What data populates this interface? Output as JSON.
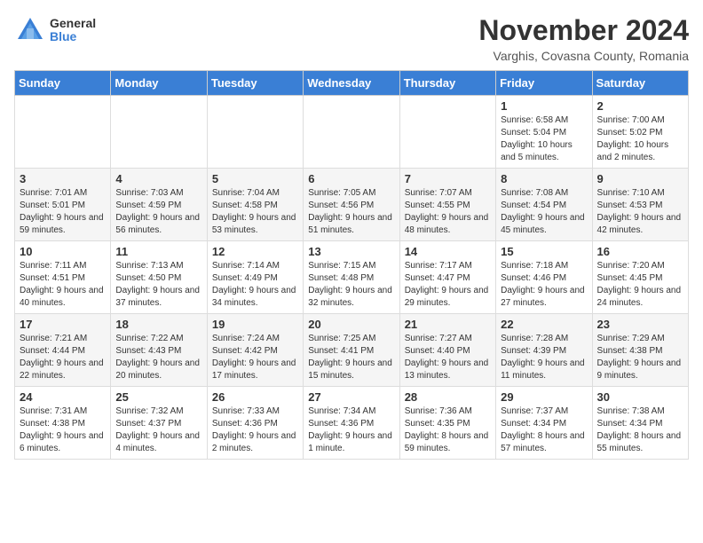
{
  "header": {
    "logo_general": "General",
    "logo_blue": "Blue",
    "month_title": "November 2024",
    "location": "Varghis, Covasna County, Romania"
  },
  "days_of_week": [
    "Sunday",
    "Monday",
    "Tuesday",
    "Wednesday",
    "Thursday",
    "Friday",
    "Saturday"
  ],
  "weeks": [
    [
      {
        "day": "",
        "info": ""
      },
      {
        "day": "",
        "info": ""
      },
      {
        "day": "",
        "info": ""
      },
      {
        "day": "",
        "info": ""
      },
      {
        "day": "",
        "info": ""
      },
      {
        "day": "1",
        "info": "Sunrise: 6:58 AM\nSunset: 5:04 PM\nDaylight: 10 hours and 5 minutes."
      },
      {
        "day": "2",
        "info": "Sunrise: 7:00 AM\nSunset: 5:02 PM\nDaylight: 10 hours and 2 minutes."
      }
    ],
    [
      {
        "day": "3",
        "info": "Sunrise: 7:01 AM\nSunset: 5:01 PM\nDaylight: 9 hours and 59 minutes."
      },
      {
        "day": "4",
        "info": "Sunrise: 7:03 AM\nSunset: 4:59 PM\nDaylight: 9 hours and 56 minutes."
      },
      {
        "day": "5",
        "info": "Sunrise: 7:04 AM\nSunset: 4:58 PM\nDaylight: 9 hours and 53 minutes."
      },
      {
        "day": "6",
        "info": "Sunrise: 7:05 AM\nSunset: 4:56 PM\nDaylight: 9 hours and 51 minutes."
      },
      {
        "day": "7",
        "info": "Sunrise: 7:07 AM\nSunset: 4:55 PM\nDaylight: 9 hours and 48 minutes."
      },
      {
        "day": "8",
        "info": "Sunrise: 7:08 AM\nSunset: 4:54 PM\nDaylight: 9 hours and 45 minutes."
      },
      {
        "day": "9",
        "info": "Sunrise: 7:10 AM\nSunset: 4:53 PM\nDaylight: 9 hours and 42 minutes."
      }
    ],
    [
      {
        "day": "10",
        "info": "Sunrise: 7:11 AM\nSunset: 4:51 PM\nDaylight: 9 hours and 40 minutes."
      },
      {
        "day": "11",
        "info": "Sunrise: 7:13 AM\nSunset: 4:50 PM\nDaylight: 9 hours and 37 minutes."
      },
      {
        "day": "12",
        "info": "Sunrise: 7:14 AM\nSunset: 4:49 PM\nDaylight: 9 hours and 34 minutes."
      },
      {
        "day": "13",
        "info": "Sunrise: 7:15 AM\nSunset: 4:48 PM\nDaylight: 9 hours and 32 minutes."
      },
      {
        "day": "14",
        "info": "Sunrise: 7:17 AM\nSunset: 4:47 PM\nDaylight: 9 hours and 29 minutes."
      },
      {
        "day": "15",
        "info": "Sunrise: 7:18 AM\nSunset: 4:46 PM\nDaylight: 9 hours and 27 minutes."
      },
      {
        "day": "16",
        "info": "Sunrise: 7:20 AM\nSunset: 4:45 PM\nDaylight: 9 hours and 24 minutes."
      }
    ],
    [
      {
        "day": "17",
        "info": "Sunrise: 7:21 AM\nSunset: 4:44 PM\nDaylight: 9 hours and 22 minutes."
      },
      {
        "day": "18",
        "info": "Sunrise: 7:22 AM\nSunset: 4:43 PM\nDaylight: 9 hours and 20 minutes."
      },
      {
        "day": "19",
        "info": "Sunrise: 7:24 AM\nSunset: 4:42 PM\nDaylight: 9 hours and 17 minutes."
      },
      {
        "day": "20",
        "info": "Sunrise: 7:25 AM\nSunset: 4:41 PM\nDaylight: 9 hours and 15 minutes."
      },
      {
        "day": "21",
        "info": "Sunrise: 7:27 AM\nSunset: 4:40 PM\nDaylight: 9 hours and 13 minutes."
      },
      {
        "day": "22",
        "info": "Sunrise: 7:28 AM\nSunset: 4:39 PM\nDaylight: 9 hours and 11 minutes."
      },
      {
        "day": "23",
        "info": "Sunrise: 7:29 AM\nSunset: 4:38 PM\nDaylight: 9 hours and 9 minutes."
      }
    ],
    [
      {
        "day": "24",
        "info": "Sunrise: 7:31 AM\nSunset: 4:38 PM\nDaylight: 9 hours and 6 minutes."
      },
      {
        "day": "25",
        "info": "Sunrise: 7:32 AM\nSunset: 4:37 PM\nDaylight: 9 hours and 4 minutes."
      },
      {
        "day": "26",
        "info": "Sunrise: 7:33 AM\nSunset: 4:36 PM\nDaylight: 9 hours and 2 minutes."
      },
      {
        "day": "27",
        "info": "Sunrise: 7:34 AM\nSunset: 4:36 PM\nDaylight: 9 hours and 1 minute."
      },
      {
        "day": "28",
        "info": "Sunrise: 7:36 AM\nSunset: 4:35 PM\nDaylight: 8 hours and 59 minutes."
      },
      {
        "day": "29",
        "info": "Sunrise: 7:37 AM\nSunset: 4:34 PM\nDaylight: 8 hours and 57 minutes."
      },
      {
        "day": "30",
        "info": "Sunrise: 7:38 AM\nSunset: 4:34 PM\nDaylight: 8 hours and 55 minutes."
      }
    ]
  ]
}
